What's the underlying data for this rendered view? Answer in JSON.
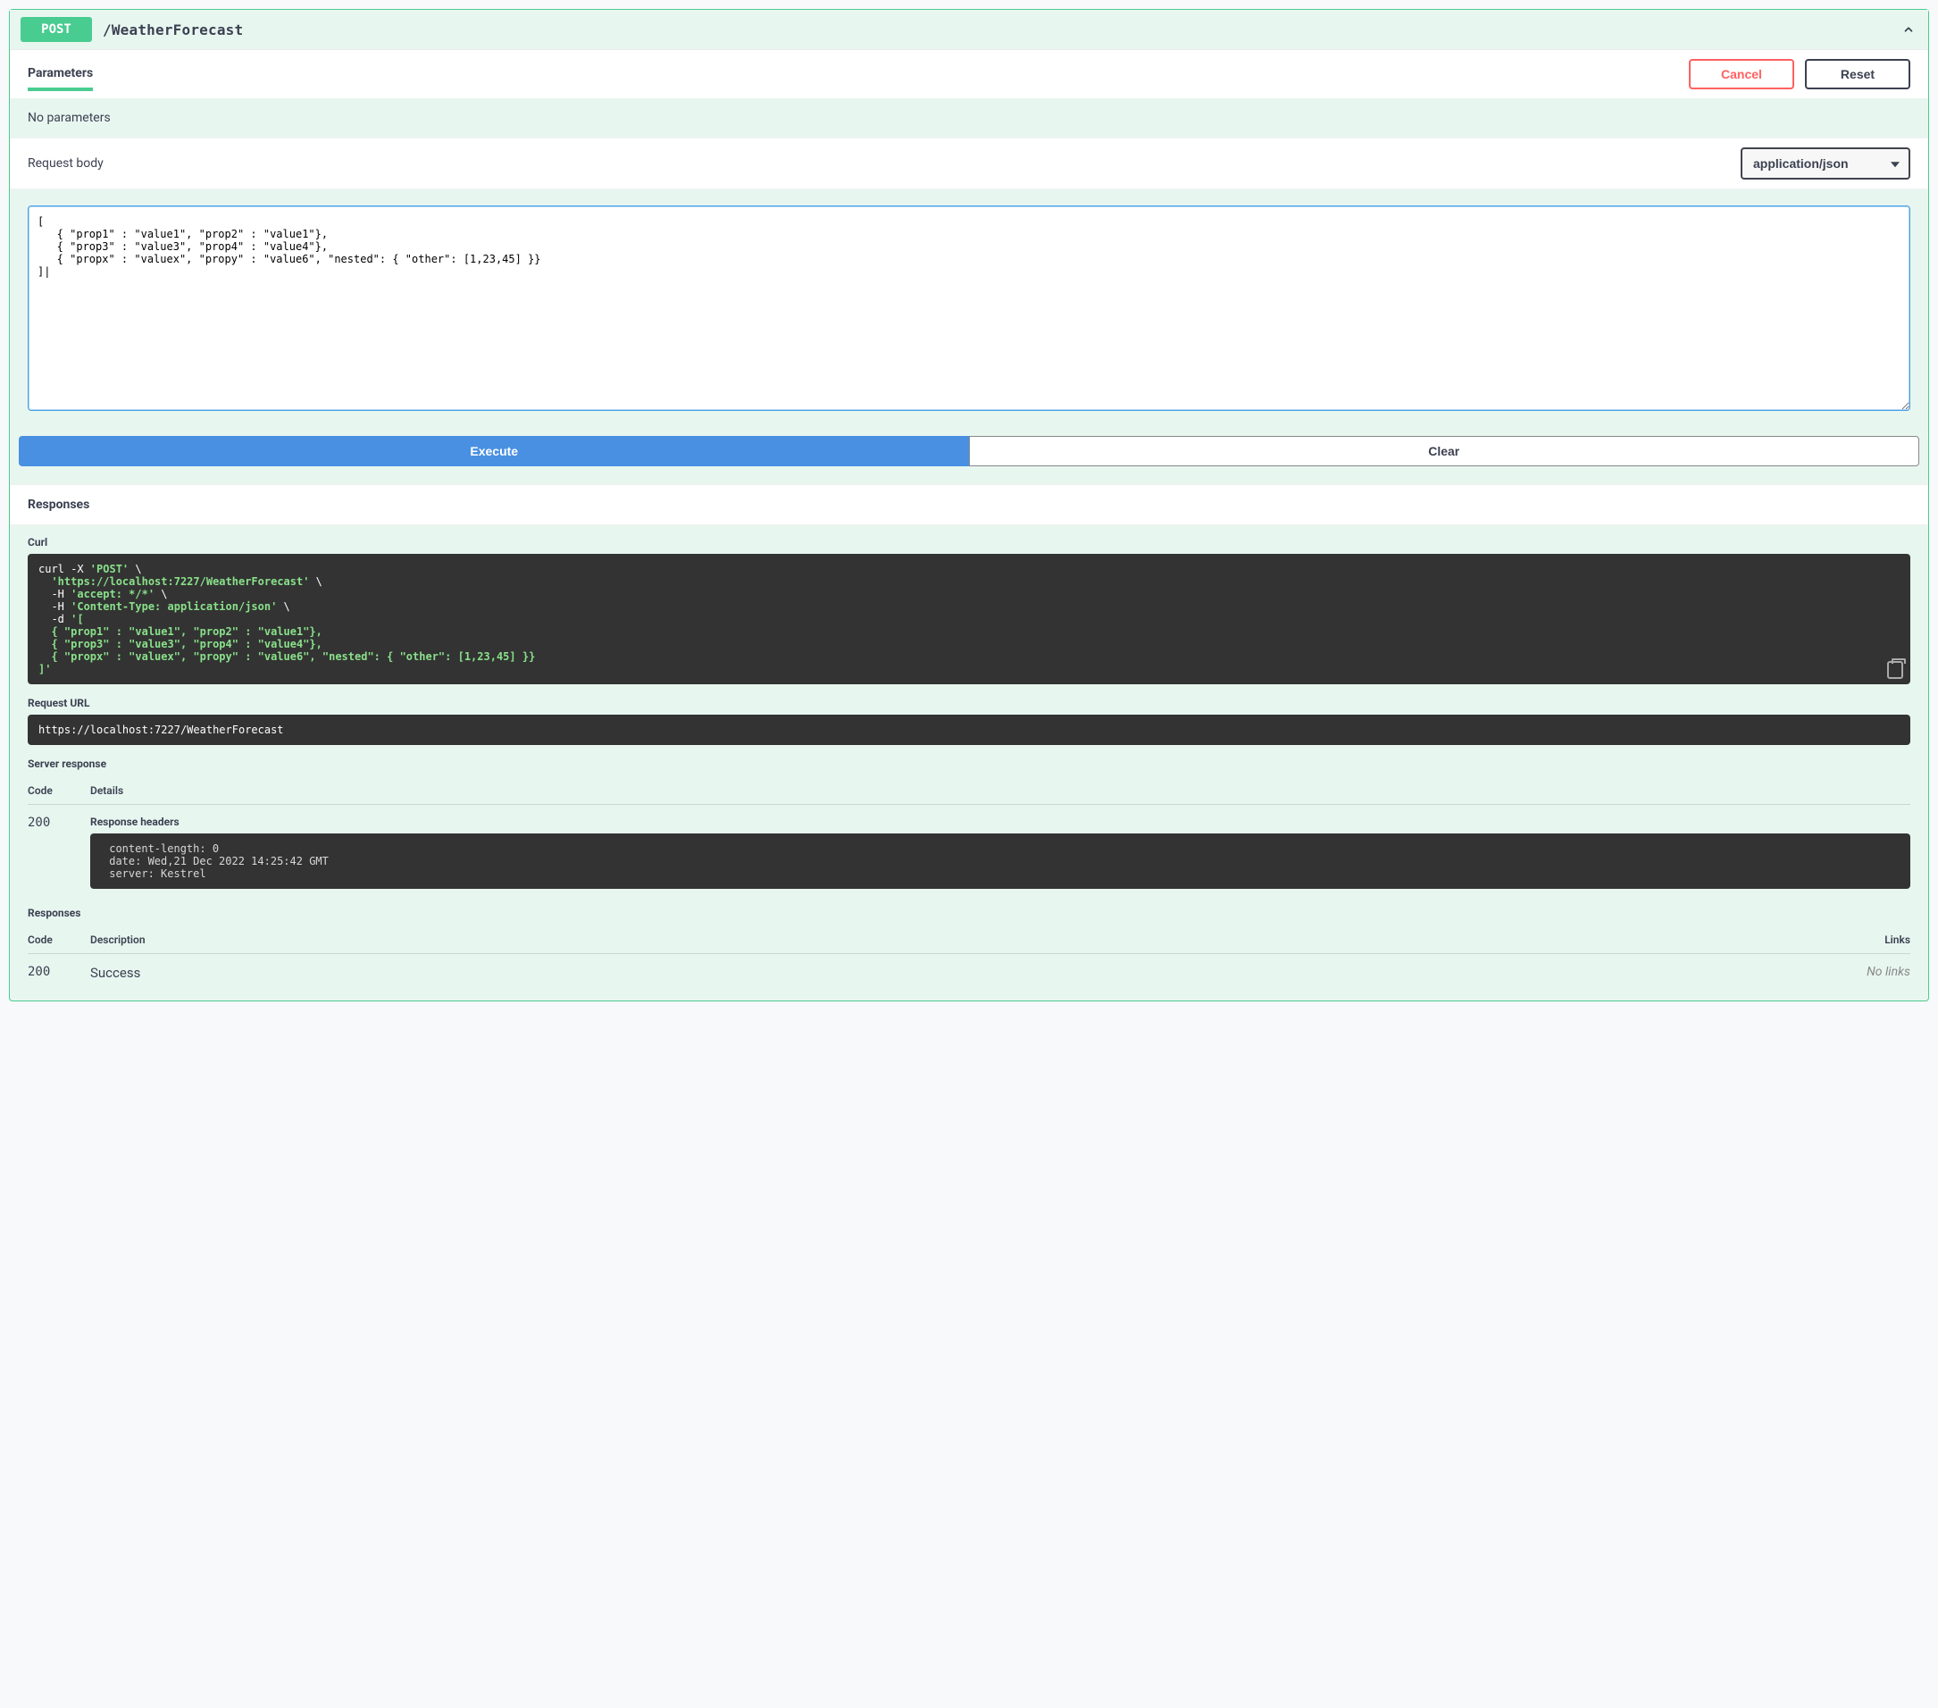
{
  "operation": {
    "method": "POST",
    "path": "/WeatherForecast"
  },
  "toolbar": {
    "parameters_tab": "Parameters",
    "cancel": "Cancel",
    "reset": "Reset"
  },
  "parameters": {
    "none_text": "No parameters"
  },
  "request_body": {
    "label": "Request body",
    "content_type": "application/json",
    "value": "[\n   { \"prop1\" : \"value1\", \"prop2\" : \"value1\"},\n   { \"prop3\" : \"value3\", \"prop4\" : \"value4\"},\n   { \"propx\" : \"valuex\", \"propy\" : \"value6\", \"nested\": { \"other\": [1,23,45] }}\n]|"
  },
  "actions": {
    "execute": "Execute",
    "clear": "Clear"
  },
  "responses": {
    "header": "Responses",
    "curl_label": "Curl",
    "curl_plain_parts": {
      "p0": "curl -X ",
      "p1": "'POST'",
      "p2": " \\\n  ",
      "p3": "'https://localhost:7227/WeatherForecast'",
      "p4": " \\\n  -H ",
      "p5": "'accept: */*'",
      "p6": " \\\n  -H ",
      "p7": "'Content-Type: application/json'",
      "p8": " \\\n  -d ",
      "p9": "'[\n  { \"prop1\" : \"value1\", \"prop2\" : \"value1\"},\n  { \"prop3\" : \"value3\", \"prop4\" : \"value4\"},\n  { \"propx\" : \"valuex\", \"propy\" : \"value6\", \"nested\": { \"other\": [1,23,45] }}\n]'"
    },
    "request_url_label": "Request URL",
    "request_url": "https://localhost:7227/WeatherForecast",
    "server_response_label": "Server response",
    "code_header": "Code",
    "details_header": "Details",
    "server_code": "200",
    "response_headers_label": "Response headers",
    "response_headers": " content-length: 0 \n date: Wed,21 Dec 2022 14:25:42 GMT \n server: Kestrel ",
    "responses_label": "Responses",
    "description_header": "Description",
    "links_header": "Links",
    "doc_code": "200",
    "doc_description": "Success",
    "no_links": "No links"
  }
}
